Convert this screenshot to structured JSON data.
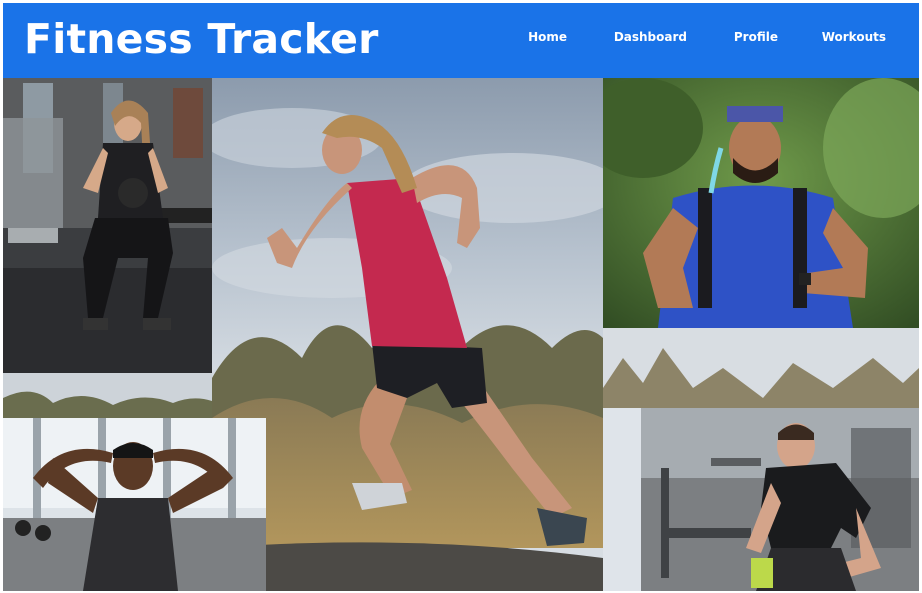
{
  "app": {
    "title": "Fitness Tracker"
  },
  "nav": {
    "items": [
      {
        "label": "Home"
      },
      {
        "label": "Dashboard"
      },
      {
        "label": "Profile"
      },
      {
        "label": "Workouts"
      }
    ]
  },
  "colors": {
    "header_bg": "#1a73e8",
    "header_text": "#ffffff"
  },
  "gallery": {
    "images": [
      {
        "subject": "woman-running-trail"
      },
      {
        "subject": "woman-kettlebell-squat"
      },
      {
        "subject": "man-trail-running-headband"
      },
      {
        "subject": "man-doing-situps"
      },
      {
        "subject": "man-crouching-gym"
      }
    ]
  }
}
